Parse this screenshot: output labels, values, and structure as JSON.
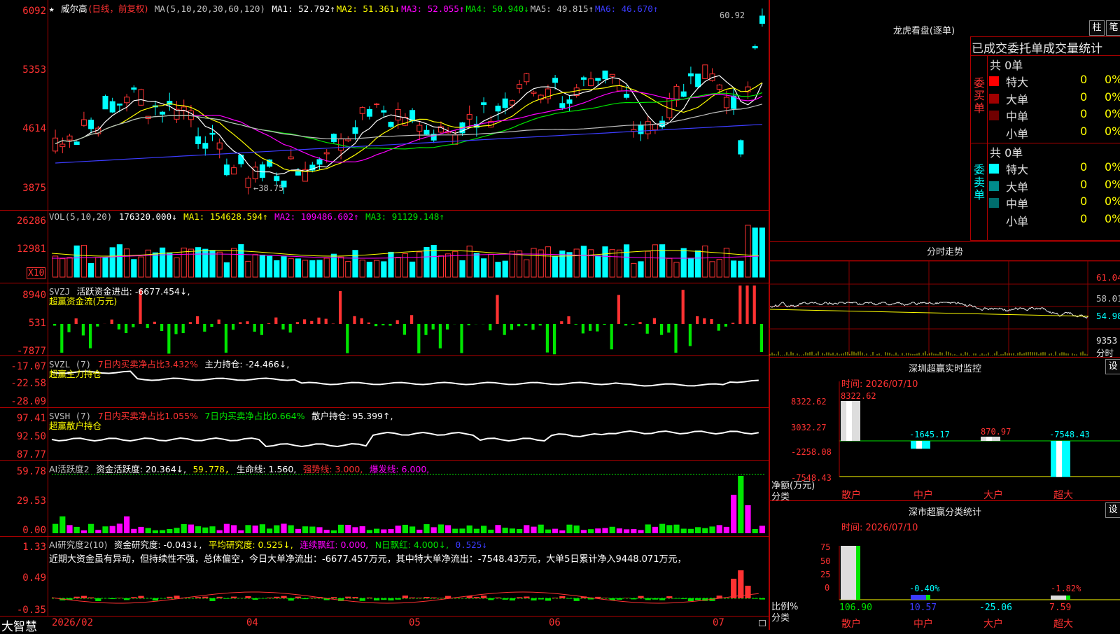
{
  "app": {
    "name": "大智慧"
  },
  "kline": {
    "star": "★",
    "stock": "威尔高",
    "period": "(日线，前复权)",
    "ma_header": "MA(5,10,20,30,60,120)",
    "ma": [
      {
        "t": "MA1: 52.792↑",
        "c": "#ffffff"
      },
      {
        "t": "MA2: 51.361↓",
        "c": "#ffff00"
      },
      {
        "t": "MA3: 52.055↑",
        "c": "#ff00ff"
      },
      {
        "t": "MA4: 50.940↓",
        "c": "#00e600"
      },
      {
        "t": "MA5: 49.815↑",
        "c": "#c0c0c0"
      },
      {
        "t": "MA6: 46.670↑",
        "c": "#3c3cff"
      }
    ],
    "y_ticks": [
      "6092",
      "5353",
      "4614",
      "3875"
    ],
    "y_values": [
      60.92,
      53.53,
      46.14,
      38.75
    ],
    "hi_label": "60.92",
    "lo_label": "←38.75"
  },
  "vol": {
    "title": "VOL(5,10,20)",
    "value": "176320.000↓",
    "ma1": "MA1: 154628.594↑",
    "ma2": "MA2: 109486.602↑",
    "ma3": "MA3: 91129.148↑",
    "y_ticks": [
      "26286",
      "12981"
    ],
    "x10": "X10"
  },
  "svzj": {
    "title": "SVZJ",
    "label": "活跃资金进出: -6677.454↓,",
    "sub": "超赢资金流(万元)",
    "y_ticks": [
      "8940",
      "531",
      "-7877"
    ]
  },
  "svzl": {
    "title": "SVZL (7)",
    "a": "7日内买卖净占比3.432%",
    "b": "主力持仓: -24.466↓,",
    "sub": "超赢主力持仓",
    "y_ticks": [
      "-17.07",
      "-22.58",
      "-28.09"
    ]
  },
  "svsh": {
    "title": "SVSH (7)",
    "a": "7日内买卖净占比1.055%",
    "b": "7日内买卖净占比0.664%",
    "c": "散户持仓: 95.399↑,",
    "sub": "超赢散户持仓",
    "y_ticks": [
      "97.41",
      "92.50",
      "87.77"
    ]
  },
  "ai1": {
    "title": "AI活跃度2",
    "a": "资金活跃度: 20.364↓,",
    "b": "59.778,",
    "c": "生命线: 1.560,",
    "d": "强势线: 3.000,",
    "e": "爆发线: 6.000,",
    "y_ticks": [
      "59.78",
      "29.53",
      "0.00"
    ]
  },
  "ai2": {
    "title": "AI研究度2(10)",
    "a": "资金研究度: -0.043↓,",
    "b": "平均研究度: 0.525↓,",
    "c": "连续飘红: 0.000,",
    "d": "N日飘红: 4.000↓,",
    "e": "0.525↓",
    "comment": "近期大资金虽有异动，但持续性不强，总体偏空，今日大单净流出：-6677.457万元，其中特大单净流出：-7548.43万元，大单5日累计净入9448.071万元，",
    "y_ticks": [
      "1.33",
      "0.49",
      "-0.35"
    ]
  },
  "xaxis": [
    "2026/02",
    "04",
    "05",
    "06",
    "07"
  ],
  "right": {
    "lhb_title": "龙虎看盘(逐单)",
    "btn1": "柱",
    "btn2": "笔",
    "table_head": "已成交委托单成交量统计",
    "buy_side": "委买单",
    "sell_side": "委卖单",
    "buy_total": "共 0单",
    "sell_total": "共 0单",
    "buy_rows": [
      {
        "name": "特大",
        "v": "0",
        "p": "0%",
        "c": "#ff0000"
      },
      {
        "name": "大单",
        "v": "0",
        "p": "0%",
        "c": "#a00000"
      },
      {
        "name": "中单",
        "v": "0",
        "p": "0%",
        "c": "#700000"
      },
      {
        "name": "小单",
        "v": "0",
        "p": "0%",
        "c": ""
      }
    ],
    "sell_rows": [
      {
        "name": "特大",
        "v": "0",
        "p": "0%",
        "c": "#00ffff"
      },
      {
        "name": "大单",
        "v": "0",
        "p": "0%",
        "c": "#008b8b"
      },
      {
        "name": "中单",
        "v": "0",
        "p": "0%",
        "c": "#006d6d"
      },
      {
        "name": "小单",
        "v": "0",
        "p": "0%",
        "c": ""
      }
    ],
    "fs_title": "分时走势",
    "fs_y": [
      "61.04",
      "58.01",
      "54.98",
      "9353"
    ],
    "fs_unit": "分时",
    "sz_title": "深圳超赢实时监控",
    "sz_btn": "设",
    "sz_time": "时间: 2026/07/10",
    "sz_y": [
      "8322.62",
      "3032.27",
      "-2258.08",
      "-7548.43"
    ],
    "sz_bars": [
      {
        "cat": "散户",
        "val": "8322.62",
        "num": 8322.62
      },
      {
        "cat": "中户",
        "val": "-1645.17",
        "num": -1645.17
      },
      {
        "cat": "大户",
        "val": "870.97",
        "num": 870.97
      },
      {
        "cat": "超大",
        "val": "-7548.43",
        "num": -7548.43
      }
    ],
    "sz_left": "净额(万元)",
    "sz_left2": "分类",
    "fl_title": "深市超赢分类统计",
    "fl_btn": "设",
    "fl_time": "时间: 2026/07/10",
    "fl_y": [
      "75",
      "50",
      "25",
      "0"
    ],
    "fl_bars": [
      {
        "cat": "散户",
        "top": "",
        "bot": "106.90",
        "num": 106.9
      },
      {
        "cat": "中户",
        "top": "-0.40%",
        "bot": "10.57",
        "num": 10.57
      },
      {
        "cat": "大户",
        "top": "",
        "bot": "-25.06",
        "num": -25.06
      },
      {
        "cat": "超大",
        "top": "-1.82%",
        "bot": "7.59",
        "num": 7.59
      }
    ],
    "fl_left": "比例%",
    "fl_left2": "分类"
  }
}
